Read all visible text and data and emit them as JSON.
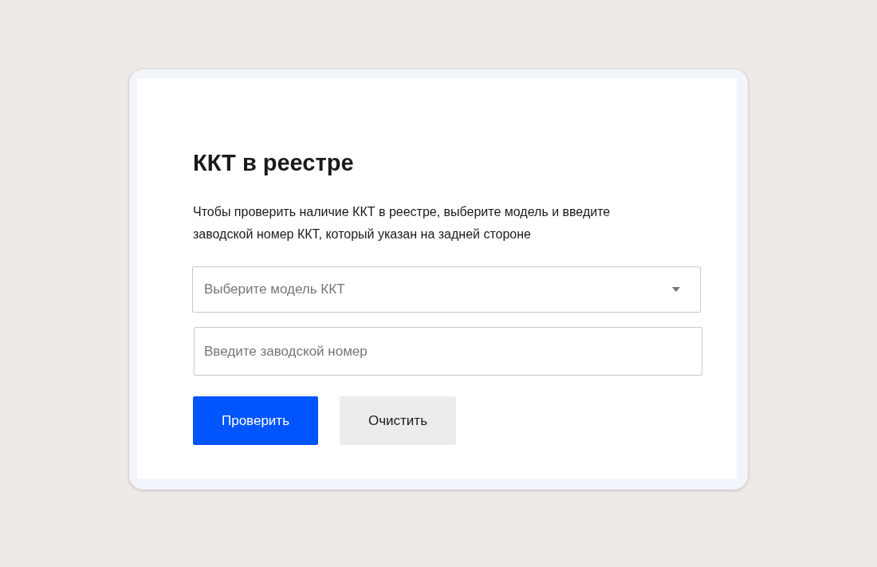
{
  "title": "ККТ в реестре",
  "description": "Чтобы проверить наличие ККТ в реестре, выберите модель и введите заводской номер ККТ, который указан на задней стороне",
  "model_select": {
    "placeholder": "Выберите модель ККТ"
  },
  "serial_field": {
    "placeholder": "Введите заводской номер"
  },
  "buttons": [
    {
      "label": "Проверить",
      "kind": "primary"
    },
    {
      "label": "Очистить",
      "kind": "secondary"
    }
  ]
}
